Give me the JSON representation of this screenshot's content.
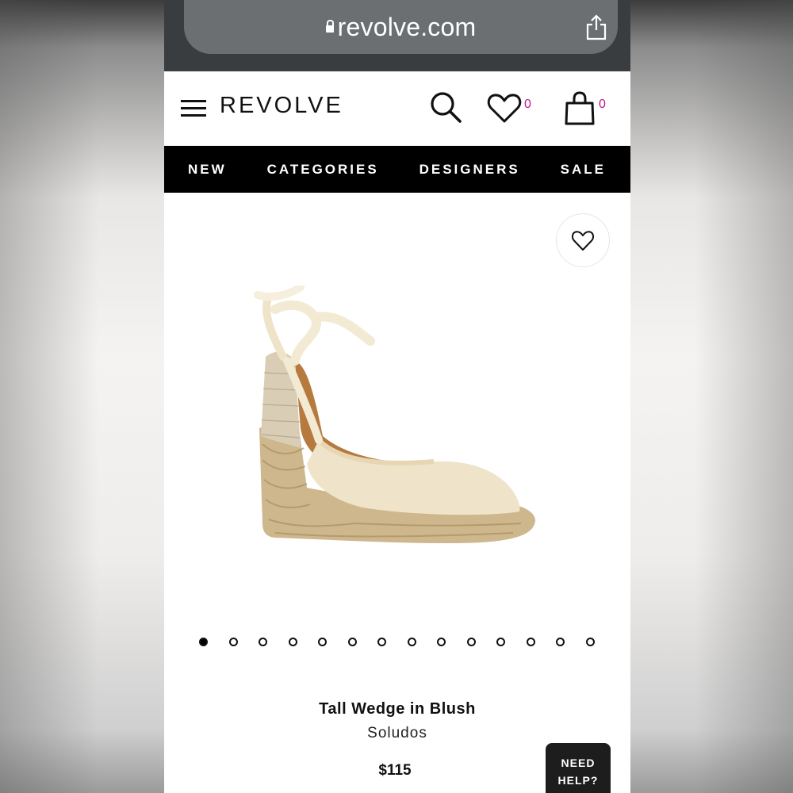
{
  "browser": {
    "url": "revolve.com",
    "lock_icon": "lock-icon",
    "share_icon": "share-icon"
  },
  "header": {
    "logo": "REVOLVE",
    "menu_icon": "hamburger-menu-icon",
    "search_icon": "search-icon",
    "wishlist_count": "0",
    "bag_count": "0"
  },
  "nav": {
    "items": [
      "NEW",
      "CATEGORIES",
      "DESIGNERS",
      "SALE"
    ]
  },
  "product": {
    "title": "Tall Wedge in Blush",
    "brand": "Soludos",
    "price": "$115",
    "image_count": 14,
    "active_image": 1
  },
  "help_button": {
    "line1": "NEED",
    "line2": "HELP?"
  },
  "colors": {
    "nav_bg": "#000000",
    "count_accent": "#c2188b",
    "browser_bg": "#3a3d40"
  }
}
